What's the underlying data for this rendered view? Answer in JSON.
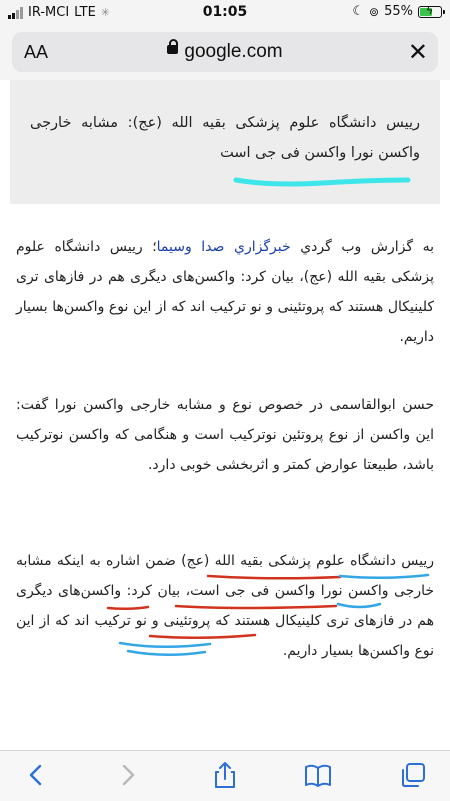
{
  "status_bar": {
    "carrier": "IR-MCI",
    "network": "LTE",
    "time": "01:05",
    "battery_percent": "55%"
  },
  "browser": {
    "text_size_label": "AA",
    "domain": "google.com"
  },
  "article": {
    "headline": "رییس دانشگاه علوم پزشکی بقیه الله (عج): مشابه خارجی واکسن نورا واکسن فی جی است",
    "paragraphs": [
      {
        "prefix": "به گزارش وب گردي ",
        "link": "خبرگزاري صدا وسيما",
        "suffix": "؛ رییس دانشگاه علوم پزشکی بقیه الله (عج)، بیان کرد: واکسن‌های دیگری هم در فازهای تری کلینیکال هستند که پروتئینی و نو ترکیب اند که از این نوع واکسن‌ها بسیار داریم."
      },
      {
        "text": "حسن ابوالقاسمی در خصوص نوع و مشابه خارجی واکسن نورا گفت: این واکسن از نوع پروتئین نوترکیب است و هنگامی که واکسن نوترکیب باشد، طبیعتا عوارض کمتر و اثربخشی خوبی دارد."
      },
      {
        "text": "رییس دانشگاه علوم پزشکی بقیه الله (عج) ضمن اشاره به اینکه مشابه خارجی واکسن نورا واکسن فی جی است، بیان کرد: واکسن‌های دیگری هم در فازهای تری کلینیکال هستند که پروتئینی و نو ترکیب اند که از این نوع واکسن‌ها بسیار داریم."
      }
    ]
  },
  "colors": {
    "highlight_cyan": "#3ee6ec",
    "underline_red": "#d2331f",
    "underline_blue": "#33a6e6",
    "link_blue": "#1a3fa8"
  },
  "icons": {
    "toolbar": [
      "back-icon",
      "forward-icon",
      "share-icon",
      "bookmarks-icon",
      "tabs-icon"
    ]
  }
}
